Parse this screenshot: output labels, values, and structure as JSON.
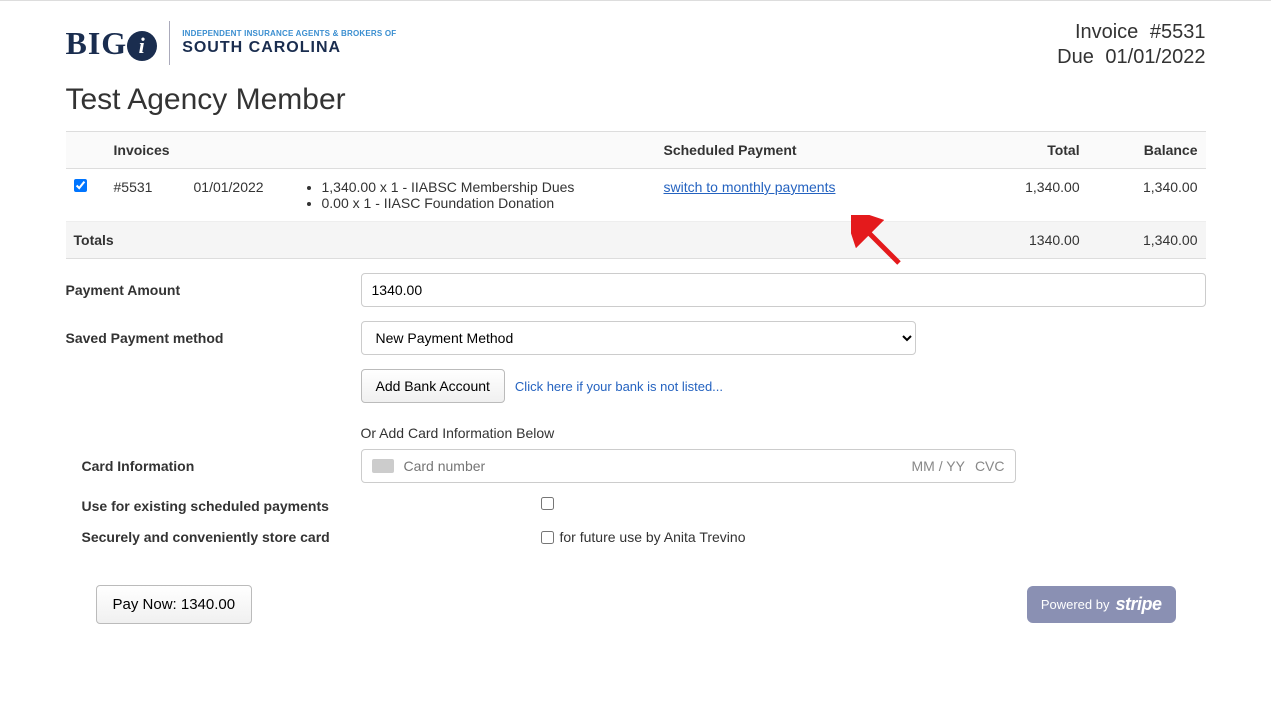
{
  "logo": {
    "big_text": "BIG",
    "sc_line1": "INDEPENDENT INSURANCE AGENTS & BROKERS OF",
    "sc_line2": "SOUTH CAROLINA"
  },
  "invoice_header": {
    "invoice_label": "Invoice",
    "invoice_number": "#5531",
    "due_label": "Due",
    "due_date": "01/01/2022"
  },
  "page_title": "Test Agency Member",
  "table": {
    "headers": {
      "invoices": "Invoices",
      "scheduled_payment": "Scheduled Payment",
      "total": "Total",
      "balance": "Balance"
    },
    "row": {
      "checked": true,
      "id": "#5531",
      "date": "01/01/2022",
      "items": [
        "1,340.00 x 1 - IIABSC Membership Dues",
        "0.00 x 1 - IIASC Foundation Donation"
      ],
      "switch_link": "switch to monthly payments",
      "total": "1,340.00",
      "balance": "1,340.00"
    },
    "totals": {
      "label": "Totals",
      "total": "1340.00",
      "balance": "1,340.00"
    }
  },
  "form": {
    "payment_amount_label": "Payment Amount",
    "payment_amount_value": "1340.00",
    "saved_method_label": "Saved Payment method",
    "saved_method_selected": "New Payment Method",
    "add_bank_btn": "Add Bank Account",
    "bank_not_listed_link": "Click here if your bank is not listed...",
    "or_add_card_text": "Or Add Card Information Below",
    "card_info_label": "Card Information",
    "card_number_placeholder": "Card number",
    "card_exp_hint": "MM / YY",
    "card_cvc_hint": "CVC",
    "use_existing_label": "Use for existing scheduled payments",
    "store_card_label": "Securely and conveniently store card",
    "store_card_suffix": "for future use by Anita Trevino"
  },
  "footer": {
    "pay_now_prefix": "Pay Now: ",
    "pay_now_amount": "1340.00",
    "stripe_prefix": "Powered by",
    "stripe_word": "stripe"
  }
}
